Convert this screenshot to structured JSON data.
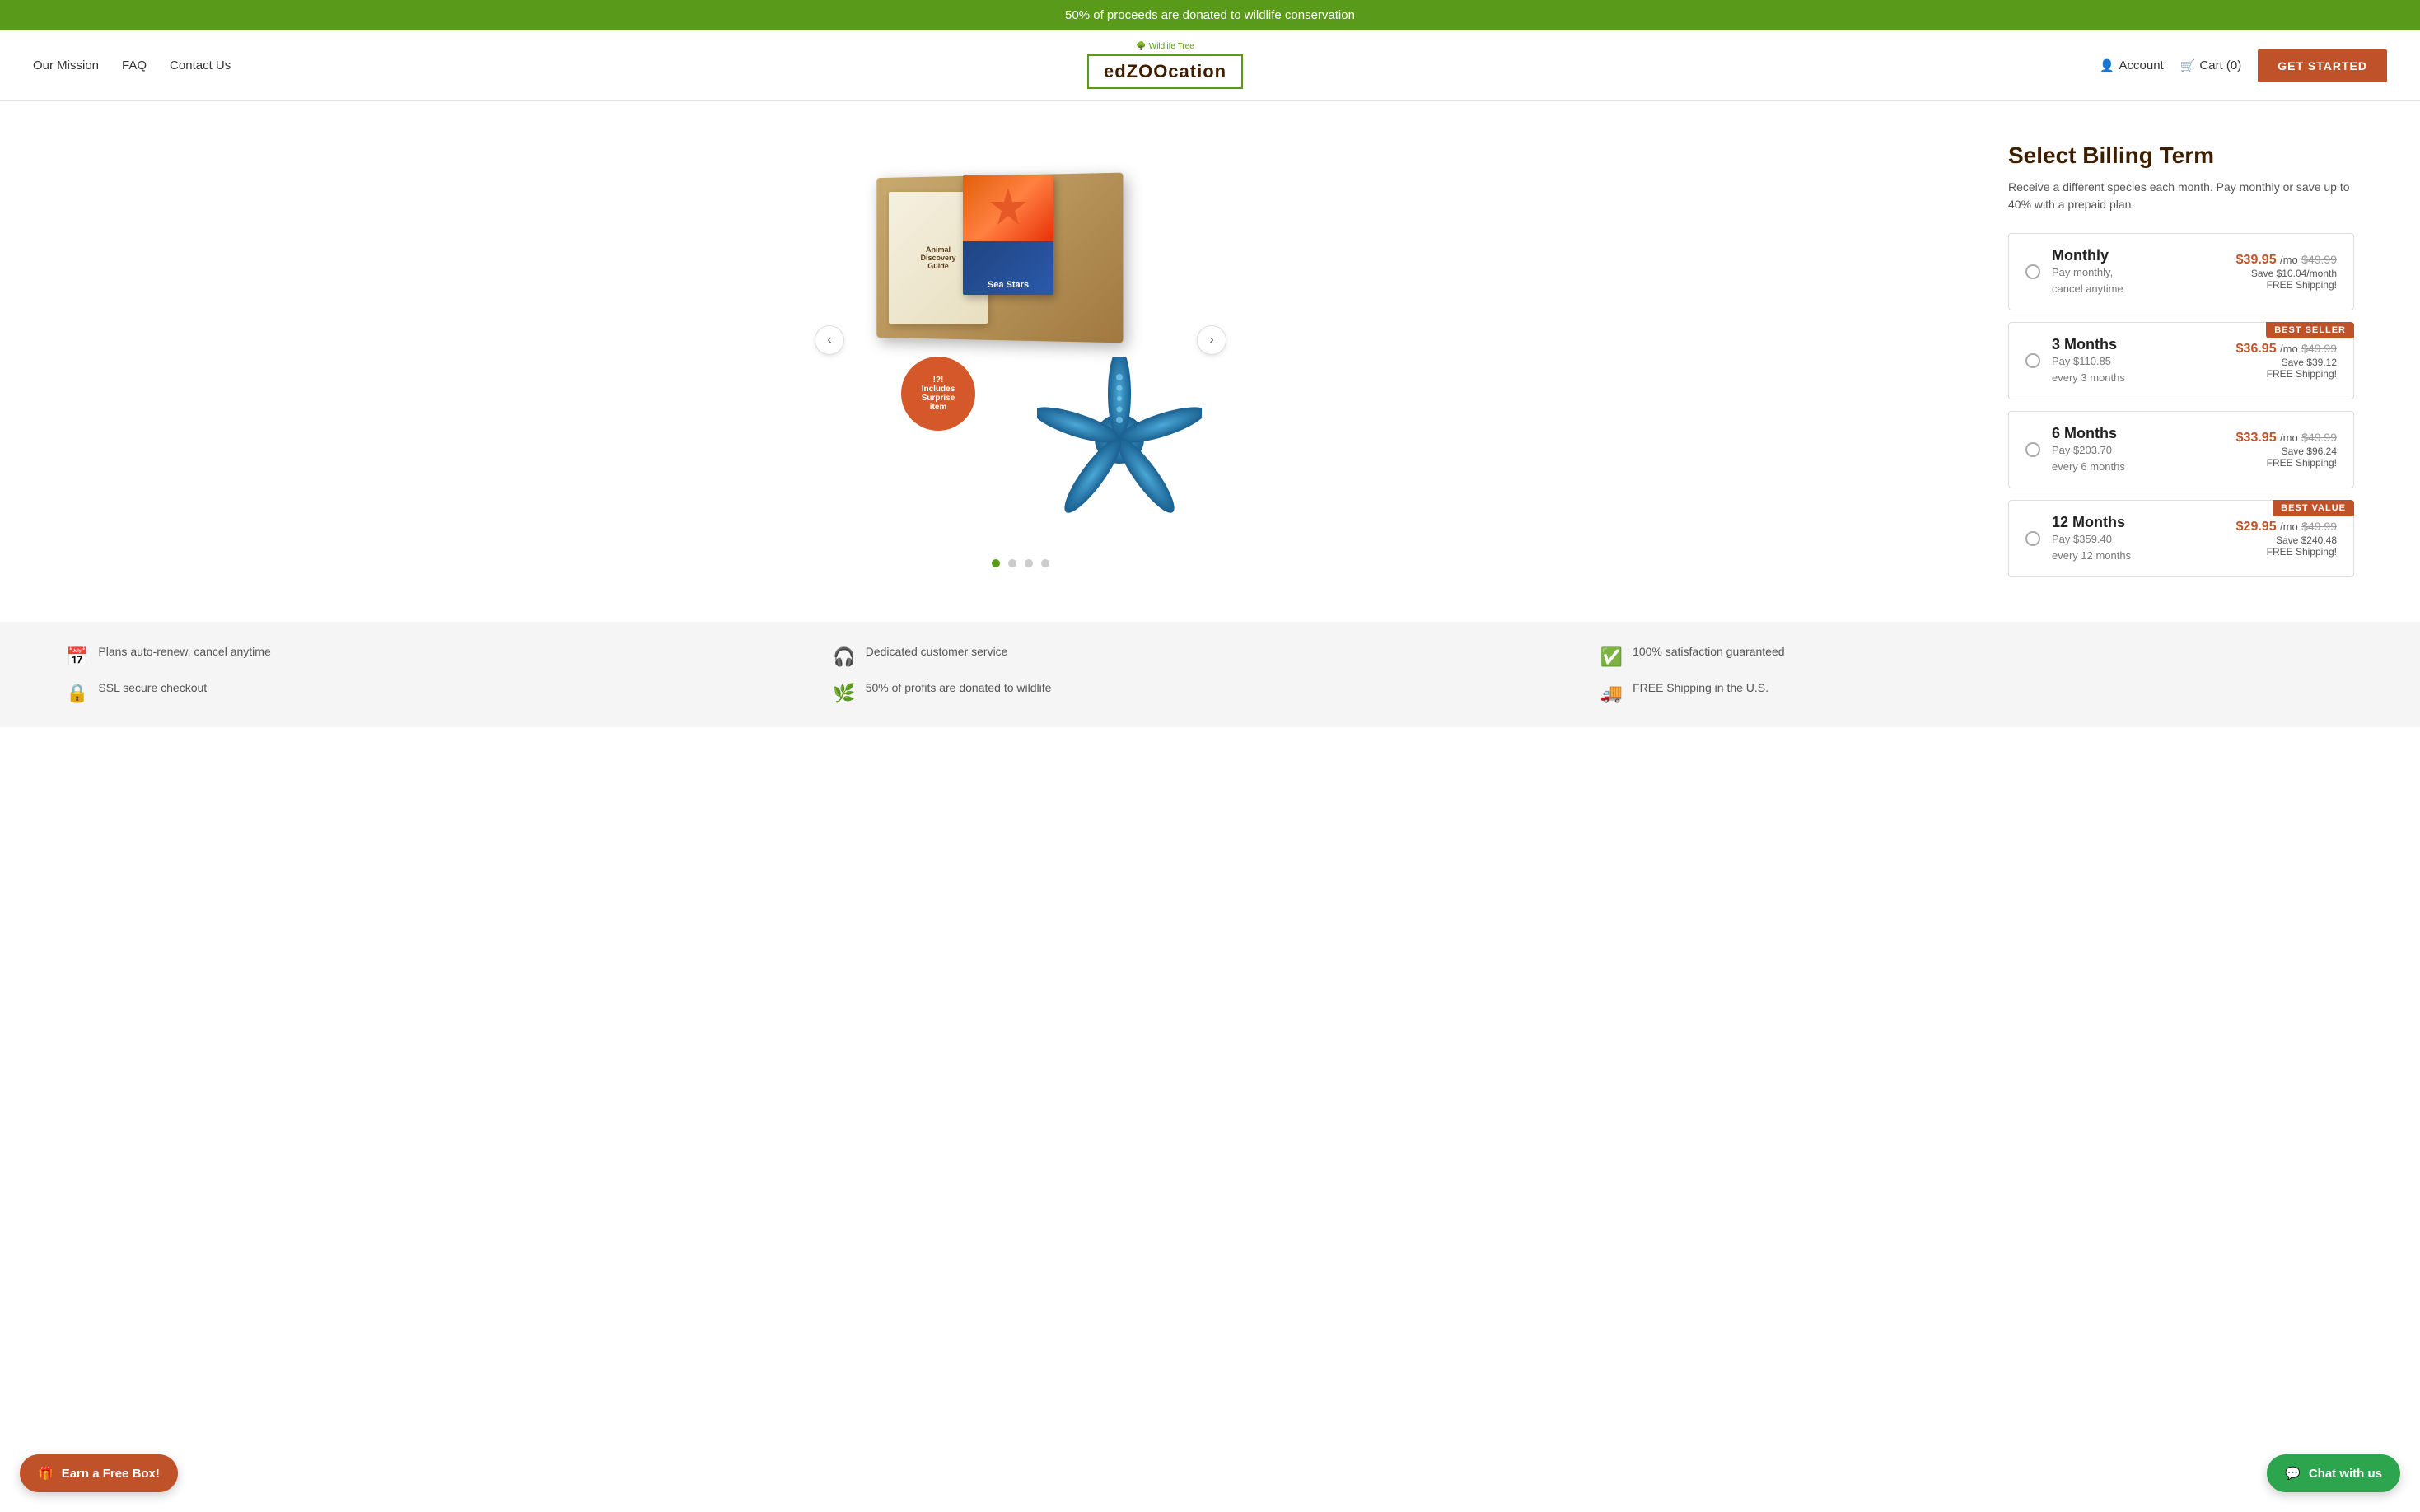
{
  "banner": {
    "text": "50% of proceeds are donated to wildlife conservation"
  },
  "header": {
    "nav_left": [
      {
        "label": "Our Mission",
        "id": "our-mission"
      },
      {
        "label": "FAQ",
        "id": "faq"
      },
      {
        "label": "Contact Us",
        "id": "contact-us"
      }
    ],
    "logo": {
      "tree_label": "Wildlife Tree",
      "brand": "edZOOcation"
    },
    "nav_right": {
      "account_label": "Account",
      "cart_label": "Cart (0)",
      "cta_label": "GET STARTED"
    }
  },
  "billing": {
    "title": "Select Billing Term",
    "subtitle": "Receive a different species each month. Pay monthly or save up to 40% with a prepaid plan.",
    "plans": [
      {
        "id": "monthly",
        "name": "Monthly",
        "sub1": "Pay monthly,",
        "sub2": "cancel anytime",
        "price_current": "$39.95",
        "price_per": "/mo",
        "price_original": "$49.99",
        "save": "Save $10.04/month",
        "shipping": "FREE Shipping!",
        "badge": null
      },
      {
        "id": "3months",
        "name": "3 Months",
        "sub1": "Pay $110.85",
        "sub2": "every 3 months",
        "price_current": "$36.95",
        "price_per": "/mo",
        "price_original": "$49.99",
        "save": "Save $39.12",
        "shipping": "FREE Shipping!",
        "badge": "BEST SELLER"
      },
      {
        "id": "6months",
        "name": "6 Months",
        "sub1": "Pay $203.70",
        "sub2": "every 6 months",
        "price_current": "$33.95",
        "price_per": "/mo",
        "price_original": "$49.99",
        "save": "Save $96.24",
        "shipping": "FREE Shipping!",
        "badge": null
      },
      {
        "id": "12months",
        "name": "12 Months",
        "sub1": "Pay $359.40",
        "sub2": "every 12 months",
        "price_current": "$29.95",
        "price_per": "/mo",
        "price_original": "$49.99",
        "save": "Save $240.48",
        "shipping": "FREE Shipping!",
        "badge": "BEST VALUE"
      }
    ]
  },
  "carousel": {
    "prev_label": "‹",
    "next_label": "›",
    "dots": [
      true,
      false,
      false,
      false
    ]
  },
  "surprise_badge": {
    "line1": "!?!",
    "line2": "Includes",
    "line3": "Surprise",
    "line4": "item"
  },
  "features": [
    {
      "icon": "📅",
      "text": "Plans auto-renew, cancel anytime"
    },
    {
      "icon": "🎧",
      "text": "Dedicated customer service"
    },
    {
      "icon": "✅",
      "text": "100% satisfaction guaranteed"
    },
    {
      "icon": "🔒",
      "text": "SSL secure checkout"
    },
    {
      "icon": "🌿",
      "text": "50% of profits are donated to wildlife"
    },
    {
      "icon": "🚚",
      "text": "FREE Shipping in the U.S."
    }
  ],
  "earn_free_box": {
    "icon": "🎁",
    "label": "Earn a Free Box!"
  },
  "chat_button": {
    "label": "Chat with us"
  }
}
